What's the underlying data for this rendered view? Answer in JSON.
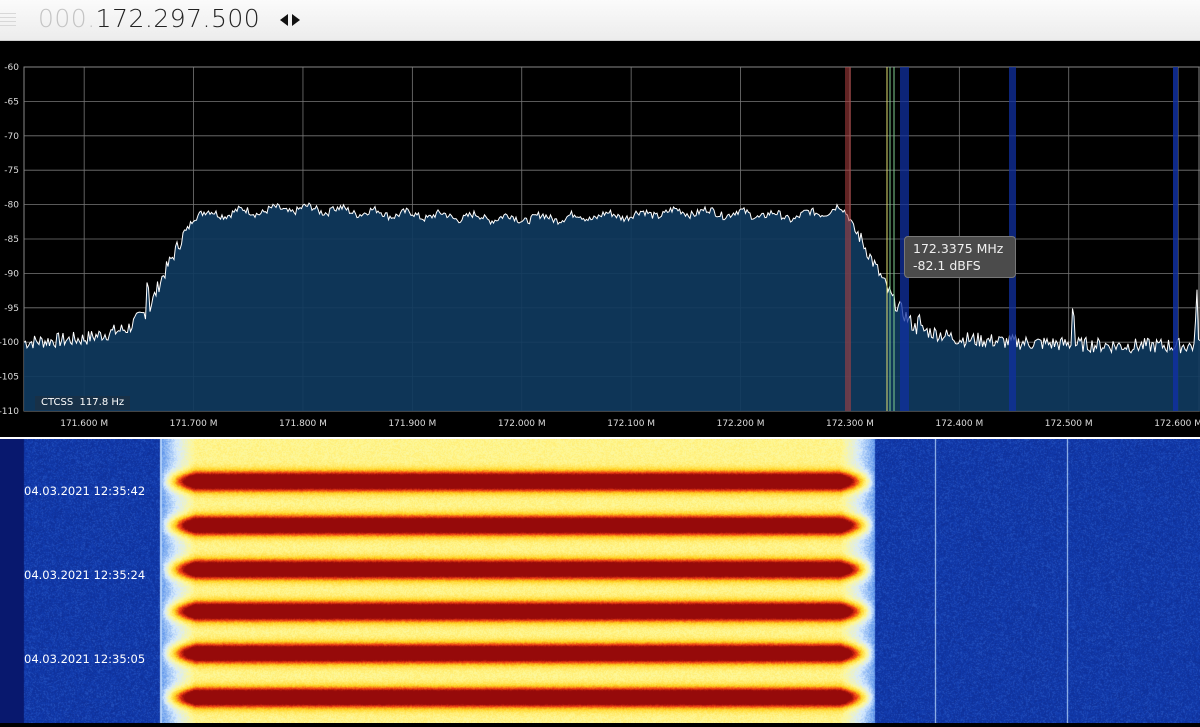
{
  "header": {
    "frequency_prefix": "000.",
    "frequency_digits": "172.297.500",
    "spinner_icon": "left-right-arrows-icon"
  },
  "spectrum": {
    "y_tick_labels": [
      "-60",
      "-65",
      "-70",
      "-75",
      "-80",
      "-85",
      "-90",
      "-95",
      "-100",
      "-105",
      "-110"
    ],
    "x_tick_labels": [
      "171.600 M",
      "171.700 M",
      "171.800 M",
      "171.900 M",
      "172.000 M",
      "172.100 M",
      "172.200 M",
      "172.300 M",
      "172.400 M",
      "172.500 M",
      "172.600 M"
    ],
    "ctcss_label": "CTCSS",
    "ctcss_value": "117.8 Hz",
    "cursor_tooltip": {
      "frequency": "172.3375 MHz",
      "level": "-82.1 dBFS"
    },
    "colors": {
      "fill": "#0f3a5e",
      "trace": "#ffffff",
      "grid": "#777777",
      "marker_red": "#b04040",
      "marker_green": "#7fd08f",
      "marker_yellow": "#e0e070",
      "marker_blue": "#1030a0"
    }
  },
  "chart_data": {
    "type": "area",
    "title": "",
    "xlabel": "",
    "ylabel": "",
    "x_unit": "MHz",
    "y_unit": "dBFS",
    "xlim": [
      171.545,
      172.62
    ],
    "ylim": [
      -110,
      -60
    ],
    "grid": true,
    "series": [
      {
        "x": [
          171.545,
          171.6,
          171.64,
          171.66,
          171.67,
          171.7,
          171.75,
          171.8,
          171.85,
          171.9,
          171.95,
          172.0,
          172.05,
          172.1,
          172.15,
          172.2,
          172.25,
          172.275,
          172.29,
          172.3,
          172.32,
          172.34,
          172.36,
          172.4,
          172.45,
          172.5,
          172.55,
          172.6,
          172.62
        ],
        "y": [
          -100,
          -99.5,
          -98,
          -95,
          -91,
          -81.5,
          -81,
          -80.6,
          -81,
          -81.5,
          -81.8,
          -82,
          -81.8,
          -81.5,
          -81,
          -81.3,
          -81.8,
          -81,
          -80.5,
          -82,
          -88,
          -94,
          -98,
          -99.5,
          -100,
          -100.3,
          -100.5,
          -100.5,
          -100.5
        ]
      }
    ],
    "peaks": [
      {
        "x": 171.658,
        "y": -89.5
      },
      {
        "x": 171.827,
        "y": -80.1
      },
      {
        "x": 172.363,
        "y": -95.0
      },
      {
        "x": 172.504,
        "y": -92.8
      },
      {
        "x": 172.617,
        "y": -91.0
      }
    ]
  },
  "waterfall": {
    "timestamps": [
      "04.03.2021 12:35:42",
      "04.03.2021 12:35:24",
      "04.03.2021 12:35:05"
    ],
    "colors": {
      "background": "#0b2a8a",
      "hot": "#e01010",
      "warm": "#ffe020"
    }
  }
}
